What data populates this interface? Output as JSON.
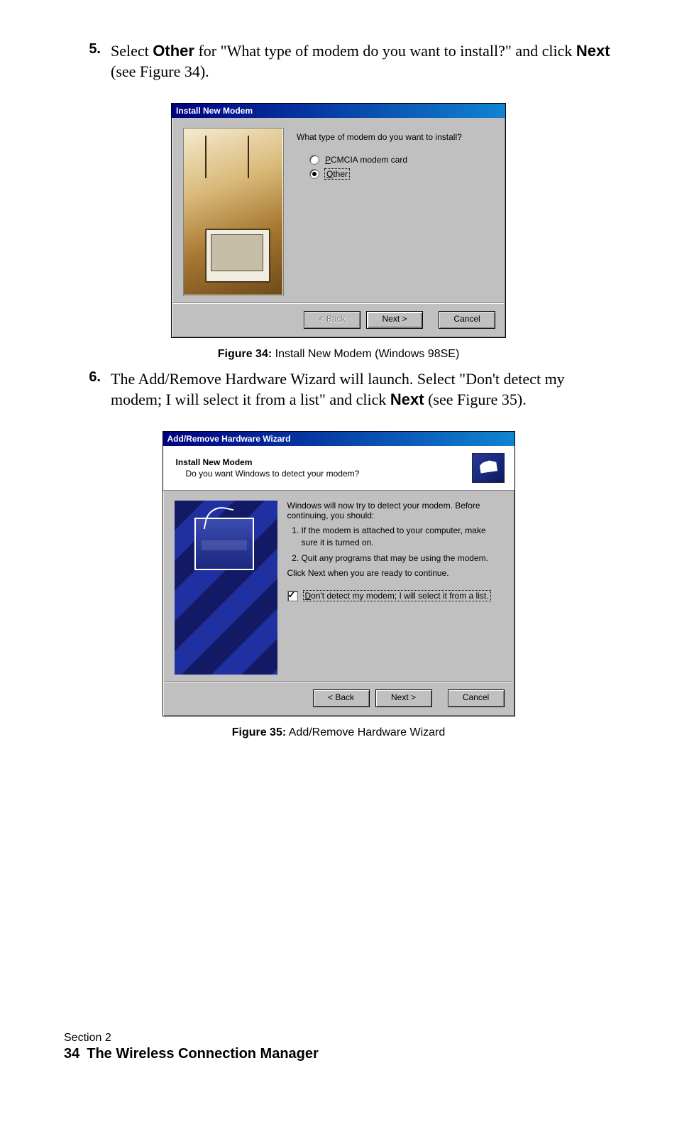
{
  "steps": {
    "s5": {
      "num": "5.",
      "pre": "Select ",
      "bold1": "Other",
      "mid": " for \"What type of modem do you want to install?\" and click ",
      "bold2": "Next",
      "post": " (see Figure 34)."
    },
    "s6": {
      "num": "6.",
      "pre": "The Add/Remove Hardware Wizard will launch. Select \"Don't detect my modem; I will select it from a list\" and click ",
      "bold1": "Next",
      "post": " (see Figure 35)."
    }
  },
  "fig34": {
    "caption_b": "Figure 34:",
    "caption_r": " Install New Modem (Windows 98SE)",
    "title": "Install New Modem",
    "question": "What type of modem do you want to install?",
    "opt1": "PCMCIA modem card",
    "opt2": "Other",
    "back": "< Back",
    "next": "Next >",
    "cancel": "Cancel"
  },
  "fig35": {
    "caption_b": "Figure 35:",
    "caption_r": " Add/Remove Hardware Wizard",
    "title": "Add/Remove Hardware Wizard",
    "hdr1": "Install New Modem",
    "hdr2": "Do you want Windows to detect your modem?",
    "intro": "Windows will now try to detect your modem.  Before continuing, you should:",
    "li1": "If the modem is attached to your computer, make sure it is turned on.",
    "li2": "Quit any programs that may be using the modem.",
    "clk": "Click Next when you are ready to continue.",
    "chk": "Don't detect my modem; I will select it from a list.",
    "back": "< Back",
    "next": "Next >",
    "cancel": "Cancel"
  },
  "footer": {
    "section": "Section 2",
    "pagenum": "34",
    "title": "The Wireless Connection Manager"
  }
}
